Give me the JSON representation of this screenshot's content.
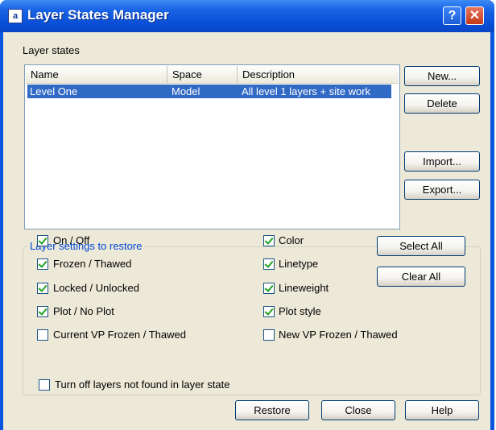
{
  "window": {
    "title": "Layer States Manager",
    "help_glyph": "?",
    "close_glyph": "✕",
    "icon_glyph": "a"
  },
  "layer_states": {
    "label": "Layer states",
    "columns": [
      "Name",
      "Space",
      "Description"
    ],
    "rows": [
      {
        "name": "Level One",
        "space": "Model",
        "description": "All level 1 layers + site work",
        "selected": true
      }
    ]
  },
  "side_buttons": {
    "new": "New...",
    "delete": "Delete",
    "import": "Import...",
    "export": "Export..."
  },
  "settings": {
    "legend": "Layer settings to restore",
    "left_items": [
      {
        "label": "On / Off",
        "checked": true
      },
      {
        "label": "Frozen / Thawed",
        "checked": true
      },
      {
        "label": "Locked / Unlocked",
        "checked": true
      },
      {
        "label": "Plot / No Plot",
        "checked": true
      },
      {
        "label": "Current VP Frozen / Thawed",
        "checked": false
      }
    ],
    "right_items": [
      {
        "label": "Color",
        "checked": true
      },
      {
        "label": "Linetype",
        "checked": true
      },
      {
        "label": "Lineweight",
        "checked": true
      },
      {
        "label": "Plot style",
        "checked": true
      },
      {
        "label": "New VP Frozen / Thawed",
        "checked": false
      }
    ],
    "select_all": "Select All",
    "clear_all": "Clear All"
  },
  "turn_off": {
    "label": "Turn off layers not found in layer state",
    "checked": false
  },
  "footer": {
    "restore": "Restore",
    "close": "Close",
    "help": "Help"
  },
  "colors": {
    "titlebar": "#0a50d8",
    "selection": "#316ac5",
    "group_legend": "#0046d5",
    "face": "#ece9d8"
  }
}
